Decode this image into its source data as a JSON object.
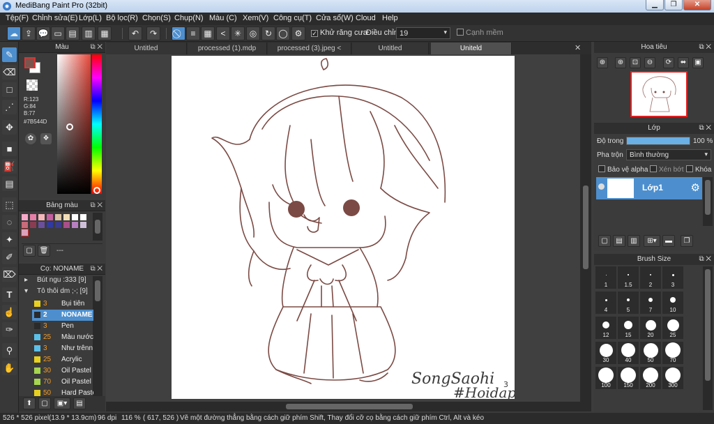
{
  "window": {
    "title": "MediBang Paint Pro (32bit)",
    "min": "▁",
    "max": "❐",
    "close": "✕"
  },
  "menu": [
    "Tệp(F)",
    "Chỉnh sửa(E)",
    "Lớp(L)",
    "Bộ lọc(R)",
    "Chọn(S)",
    "Chụp(N)",
    "Màu (C)",
    "Xem(V)",
    "Công cụ(T)",
    "Cửa sổ(W)",
    "Cloud",
    "Help"
  ],
  "toolbar": {
    "antialias_label": "Khử răng cưa",
    "antialias_checked": "✓",
    "correction_label": "Điều chỉnh",
    "correction_value": "19",
    "edge_label": "Cạnh mềm"
  },
  "color_panel": {
    "title": "Màu",
    "rgb_r": "R:123",
    "rgb_g": "G:84",
    "rgb_b": "B:77",
    "hex": "#7B544D",
    "fg_color": "#7b544d"
  },
  "palette_panel": {
    "title": "Bảng màu",
    "footer_text": "---",
    "swatches": [
      "#f7a8c9",
      "#e77ea8",
      "#f5b6b9",
      "#c55ea0",
      "#d9c3a5",
      "#f2ddb6",
      "#ffffff",
      "#ffffff",
      "#c86b7a",
      "#8a3d52",
      "#6c4f9c",
      "#2f3aa2",
      "#3b3b8f",
      "#a94f8a",
      "#b880c1",
      "#cfc0da",
      "#e0a0b8"
    ]
  },
  "brush_panel": {
    "title": "Cọ: NONAME",
    "groups": [
      "Bút ngu :333 [9]",
      "Tô thôi dm ;-; [9]"
    ],
    "brushes": [
      {
        "size": "3",
        "name": "Bụi tiên",
        "color": "#e8d020"
      },
      {
        "size": "2",
        "name": "NONAME",
        "color": "#2a2a2a"
      },
      {
        "size": "3",
        "name": "Pen",
        "color": "#2a2a2a"
      },
      {
        "size": "25",
        "name": "Màu nước",
        "color": "#5bc0e8"
      },
      {
        "size": "3",
        "name": "Như trênn",
        "color": "#5bc0e8"
      },
      {
        "size": "25",
        "name": "Acrylic",
        "color": "#e8d020"
      },
      {
        "size": "30",
        "name": "Oil Pastel",
        "color": "#a6d64e"
      },
      {
        "size": "70",
        "name": "Oil Pastel",
        "color": "#a6d64e"
      },
      {
        "size": "50",
        "name": "Hard Pastel",
        "color": "#e8d020"
      }
    ]
  },
  "doc_tabs": [
    "Untitled",
    "processed (1).mdp",
    "processed (3).jpeg < sRGB >",
    "Untitled",
    "Uniteld"
  ],
  "navigator": {
    "title": "Hoa tiêu"
  },
  "layer_panel": {
    "title": "Lớp",
    "opacity_label": "Độ trong",
    "opacity_value": "100 %",
    "opacity_fraction": 1.0,
    "blend_label": "Pha trộn",
    "blend_value": "Bình thường",
    "protect_alpha": "Bảo vệ alpha",
    "clipping": "Xén bớt",
    "lock": "Khóa",
    "layer_name": "Lớp1"
  },
  "brush_size_panel": {
    "title": "Brush Size",
    "sizes": [
      "1",
      "1.5",
      "2",
      "3",
      "4",
      "5",
      "7",
      "10",
      "12",
      "15",
      "20",
      "25",
      "30",
      "40",
      "50",
      "70",
      "100",
      "150",
      "200",
      "300"
    ]
  },
  "artwork": {
    "signature_line1": "SongSaohi",
    "signature_line2": "#Hoidap",
    "signature_sup": "3",
    "ink": "#7b4a44"
  },
  "status": {
    "size": "526 * 526 pixel",
    "cm": "(13.9 * 13.9cm)",
    "dpi": "96 dpi",
    "zoom": "116 %",
    "coords": "( 617, 526 )",
    "hint": "Vẽ một đường thẳng bằng cách giữ phím Shift, Thay đổi cỡ cọ bằng cách giữ phím Ctrl, Alt và kéo"
  }
}
